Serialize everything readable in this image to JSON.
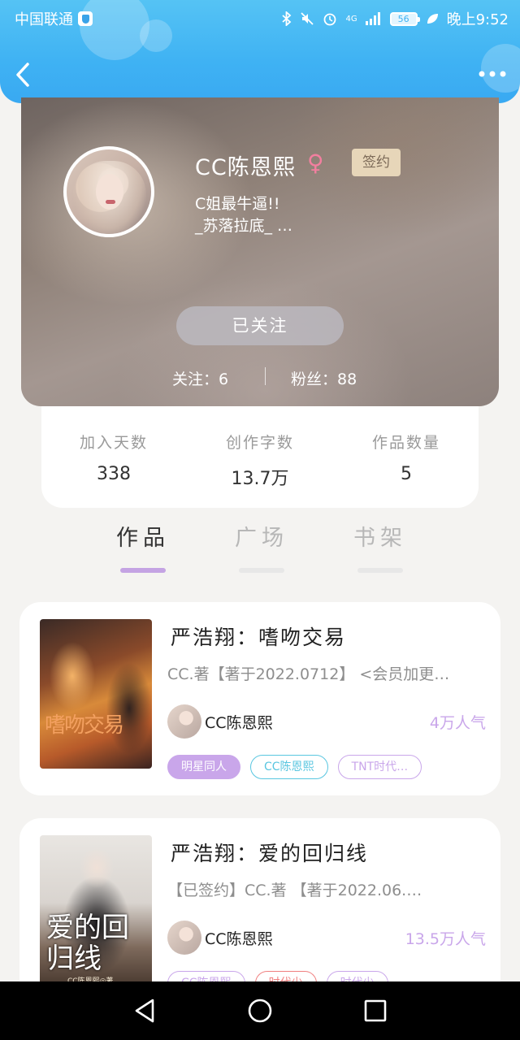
{
  "status_bar": {
    "carrier": "中国联通",
    "network": "4G",
    "battery": "56",
    "time": "晚上9:52"
  },
  "profile": {
    "name": "CC陈恩熙",
    "gender_symbol": "♀",
    "sign_badge": "签约",
    "bio_line1": "C姐最牛逼!!",
    "bio_line2": "_苏落拉底_ …",
    "follow_button": "已关注",
    "following_label": "关注：",
    "following_count": "6",
    "fans_label": "粉丝：",
    "fans_count": "88"
  },
  "stats": [
    {
      "label": "加入天数",
      "value": "338"
    },
    {
      "label": "创作字数",
      "value": "13.7万"
    },
    {
      "label": "作品数量",
      "value": "5"
    }
  ],
  "tabs": [
    {
      "label": "作品",
      "active": true
    },
    {
      "label": "广场",
      "active": false
    },
    {
      "label": "书架",
      "active": false
    }
  ],
  "books": [
    {
      "title": "严浩翔：嗜吻交易",
      "description": "CC.著【著于2022.0712】 <会员加更…",
      "author": "CC陈恩熙",
      "popularity": "4万人气",
      "cover_text": "嗜吻交易",
      "tags": [
        "明星同人",
        "CC陈恩熙",
        "TNT时代…"
      ]
    },
    {
      "title": "严浩翔：爱的回归线",
      "description": "【已签约】CC.著 【著于2022.06.…",
      "author": "CC陈恩熙",
      "popularity": "13.5万人气",
      "cover_text": "爱的回归线",
      "cover_subtext": "CC陈恩熙◎著",
      "tags": [
        "CC陈恩熙",
        "时代少",
        "时代少"
      ]
    }
  ],
  "colors": {
    "header_blue": "#3fb2f3",
    "accent_purple": "#c9a6ea",
    "gender_pink": "#f27f9f"
  }
}
